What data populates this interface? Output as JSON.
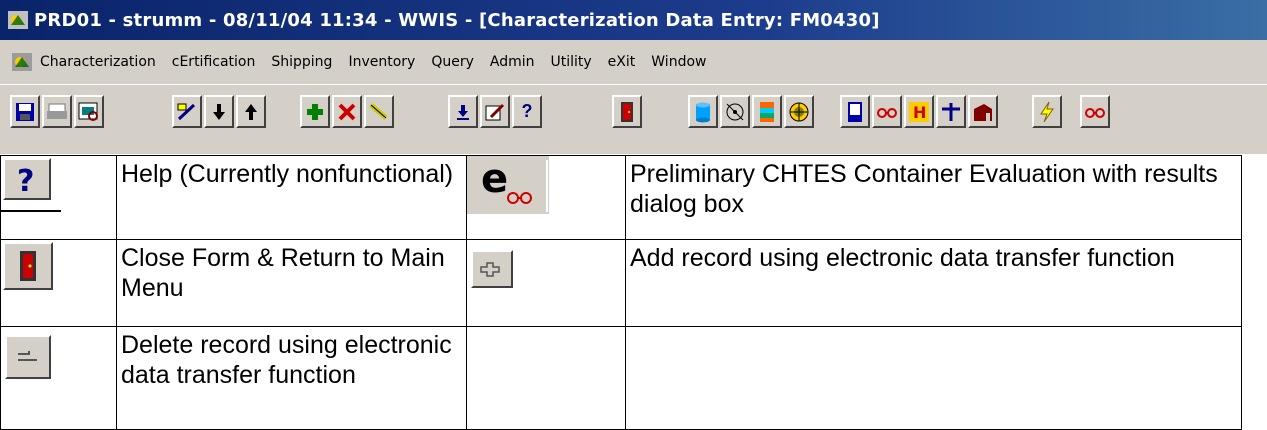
{
  "window": {
    "title": "PRD01 - strumm - 08/11/04 11:34 - WWIS - [Characterization Data Entry: FM0430]"
  },
  "menu": {
    "items": [
      "Characterization",
      "cErtification",
      "Shipping",
      "Inventory",
      "Query",
      "Admin",
      "Utility",
      "eXit",
      "Window"
    ]
  },
  "toolbar": {
    "buttons": [
      "save-icon",
      "print-icon",
      "preview-icon",
      "wand-icon",
      "arrow-down-icon",
      "arrow-up-icon",
      "add-icon",
      "delete-icon",
      "edit-icon",
      "download-icon",
      "pencil-icon",
      "help-icon",
      "exit-door-icon",
      "database-icon",
      "radiation-icon",
      "container-icon",
      "target-icon",
      "tank-icon",
      "glasses-icon",
      "hazard-h-icon",
      "pipe-icon",
      "building-icon",
      "lightning-icon",
      "glasses-red-icon"
    ],
    "help_glyph": "?"
  },
  "legend": {
    "rows": [
      {
        "left_icon": "help-icon",
        "left_glyph": "?",
        "left_text": "Help (Currently nonfunctional)",
        "right_icon": "chtes-evaluation-icon",
        "right_glyph": "e",
        "right_text": "Preliminary CHTES Container Evaluation with results dialog box"
      },
      {
        "left_icon": "close-form-icon",
        "left_text": "Close Form & Return to Main Menu",
        "right_icon": "add-record-transfer-icon",
        "right_text": "Add record using electronic data transfer function"
      },
      {
        "left_icon": "delete-record-transfer-icon",
        "left_text": "Delete record using electronic data transfer function",
        "right_icon": "",
        "right_text": ""
      }
    ]
  },
  "colors": {
    "titlebar": "#0a246a",
    "chrome": "#d4d0c8",
    "accent_red": "#cc0000"
  }
}
